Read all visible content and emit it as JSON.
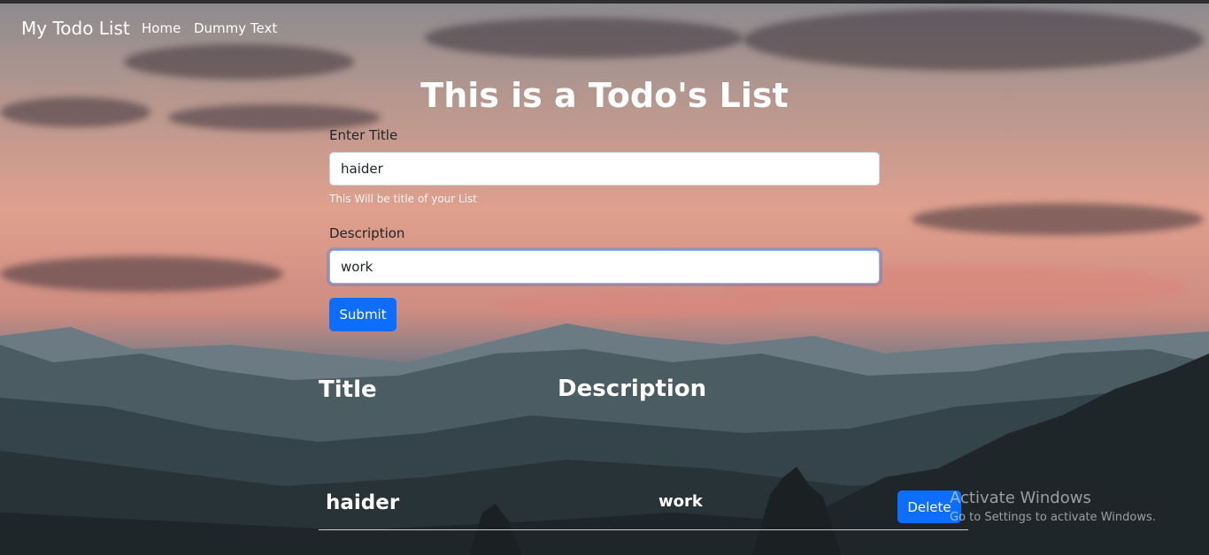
{
  "navbar": {
    "brand": "My Todo List",
    "links": [
      "Home",
      "Dummy Text"
    ]
  },
  "heading": "This is a Todo's List",
  "form": {
    "title_label": "Enter Title",
    "title_value": "haider",
    "title_help": "This Will be title of your List",
    "description_label": "Description",
    "description_value": "work",
    "submit_label": "Submit"
  },
  "table": {
    "headers": [
      "Title",
      "Description"
    ],
    "rows": [
      {
        "title": "haider",
        "description": "work",
        "action_label": "Delete"
      }
    ]
  },
  "watermark": {
    "line1": "Activate Windows",
    "line2": "Go to Settings to activate Windows."
  },
  "colors": {
    "primary": "#0d6efd",
    "text_white": "#ffffff"
  }
}
